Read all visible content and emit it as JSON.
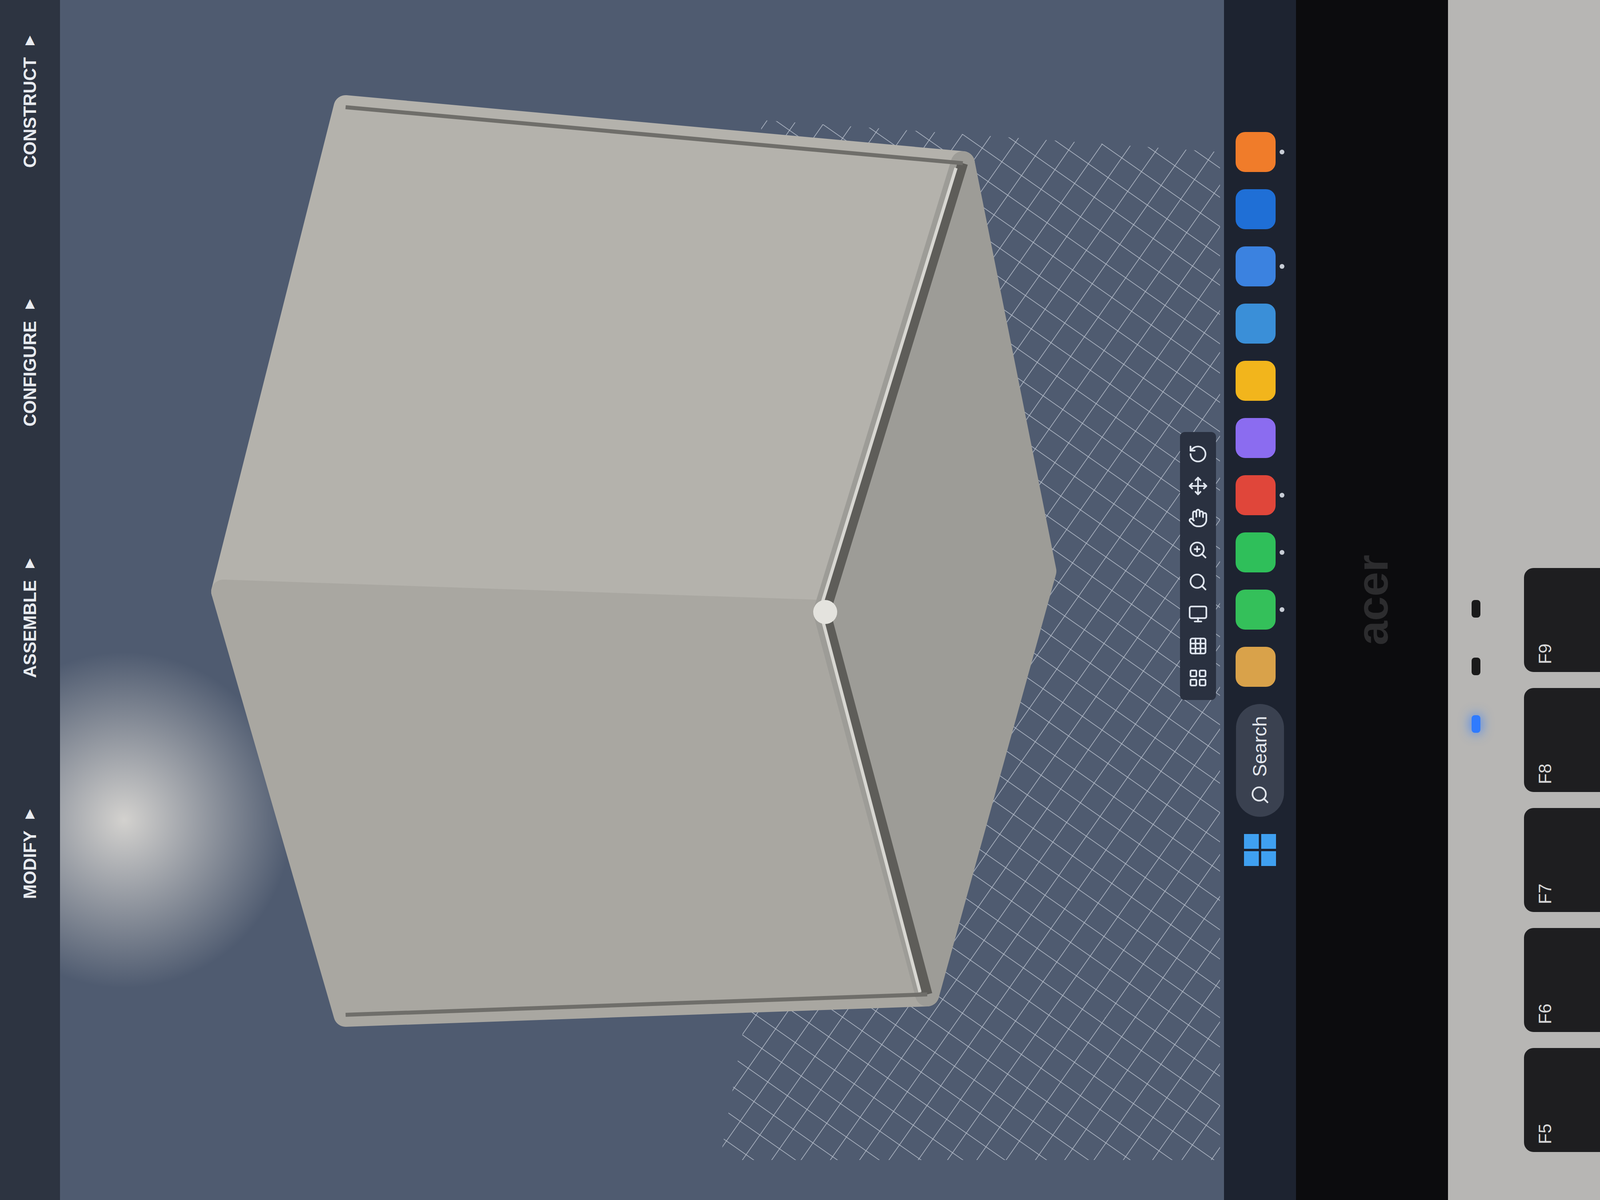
{
  "toolbar": {
    "menus": [
      {
        "label": "CONSTRUCT ▾"
      },
      {
        "label": "CONFIGURE ▾"
      },
      {
        "label": "ASSEMBLE ▾"
      },
      {
        "label": "MODIFY ▾"
      }
    ]
  },
  "taskbar": {
    "apps": [
      {
        "color": "#f07c2a",
        "running": true
      },
      {
        "color": "#1f6fd6",
        "running": false
      },
      {
        "color": "#3b82e0",
        "running": true
      },
      {
        "color": "#3a8fd8",
        "running": false
      },
      {
        "color": "#f2b51c",
        "running": false
      },
      {
        "color": "#8b6cf0",
        "running": false
      },
      {
        "color": "#e0463a",
        "running": true
      },
      {
        "color": "#2fbf5a",
        "running": true
      },
      {
        "color": "#34c05a",
        "running": true
      },
      {
        "color": "#d9a24a",
        "running": false
      }
    ],
    "search": {
      "placeholder": "Search"
    }
  },
  "bezel": {
    "brand": "acer"
  },
  "keyboard": {
    "indicators": [
      {
        "on": false,
        "color": "#1a1a1a"
      },
      {
        "on": false,
        "color": "#1a1a1a"
      },
      {
        "on": true,
        "color": "#2f7bff"
      }
    ],
    "keys": [
      "F9",
      "F8",
      "F7",
      "F6",
      "F5"
    ]
  }
}
